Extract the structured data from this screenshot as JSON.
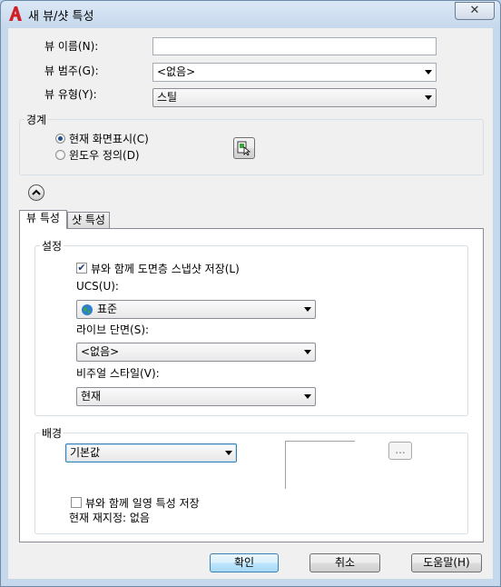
{
  "window": {
    "title": "새 뷰/샷 특성",
    "close_label": "✕"
  },
  "fields": {
    "view_name": {
      "label": "뷰 이름(N):",
      "value": ""
    },
    "view_category": {
      "label": "뷰 범주(G):",
      "value": "<없음>"
    },
    "view_type": {
      "label": "뷰 유형(Y):",
      "value": "스틸"
    }
  },
  "boundary": {
    "title": "경계",
    "option_current": "현재 화면표시(C)",
    "option_window": "윈도우 정의(D)",
    "selected": "current"
  },
  "tabs": [
    {
      "label": "뷰 특성",
      "active": true
    },
    {
      "label": "샷 특성",
      "active": false
    }
  ],
  "settings": {
    "title": "설정",
    "save_layer_snapshot": {
      "label": "뷰와 함께 도면층 스냅샷 저장(L)",
      "checked": true
    },
    "ucs": {
      "label": "UCS(U):",
      "value": "표준"
    },
    "live_section": {
      "label": "라이브 단면(S):",
      "value": "<없음>"
    },
    "visual_style": {
      "label": "비주얼 스타일(V):",
      "value": "현재"
    }
  },
  "background": {
    "title": "배경",
    "type_value": "기본값",
    "browse_label": "...",
    "save_sun_properties": {
      "label": "뷰와 함께 일영 특성 저장",
      "checked": false
    },
    "current_override": "현재 재지정: 없음"
  },
  "buttons": {
    "ok": "확인",
    "cancel": "취소",
    "help": "도움말(H)"
  }
}
